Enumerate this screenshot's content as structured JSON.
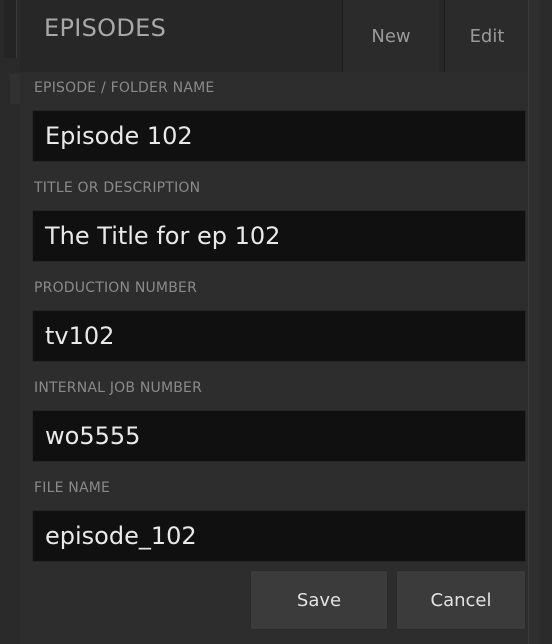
{
  "header": {
    "title": "EPISODES",
    "new_label": "New",
    "edit_label": "Edit"
  },
  "form": {
    "fields": [
      {
        "label": "EPISODE / FOLDER NAME",
        "value": "Episode 102"
      },
      {
        "label": "TITLE OR DESCRIPTION",
        "value": "The Title for ep 102"
      },
      {
        "label": "PRODUCTION NUMBER",
        "value": "tv102"
      },
      {
        "label": "INTERNAL JOB NUMBER",
        "value": "wo5555"
      },
      {
        "label": "FILE NAME",
        "value": "episode_102"
      }
    ]
  },
  "actions": {
    "save_label": "Save",
    "cancel_label": "Cancel"
  }
}
